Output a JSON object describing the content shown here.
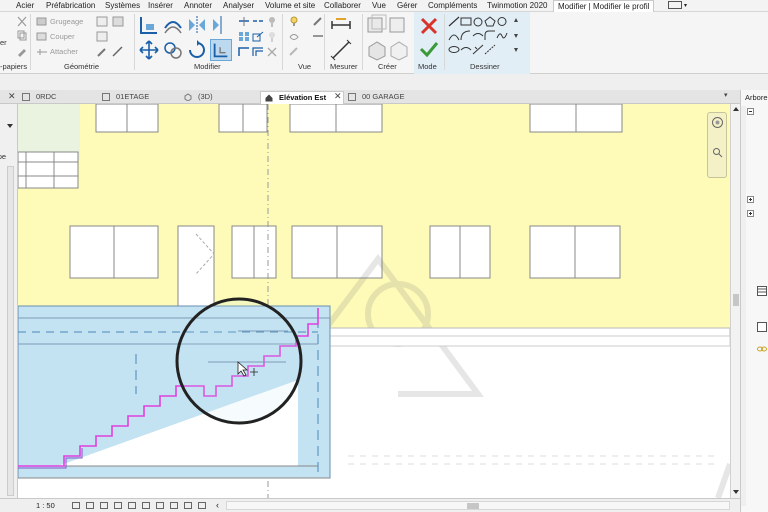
{
  "menu": {
    "items": [
      "Acier",
      "Préfabrication",
      "Systèmes",
      "Insérer",
      "Annoter",
      "Analyser",
      "Volume et site",
      "Collaborer",
      "Vue",
      "Gérer",
      "Compléments",
      "Twinmotion 2020"
    ],
    "active_tab": "Modifier | Modifier le profil"
  },
  "ribbon": {
    "clipboard_group": "-papiers",
    "clipboard_left_label": "er",
    "cmd_grugeage": "Grugeage",
    "cmd_couper": "Couper",
    "cmd_attacher": "Attacher",
    "panels": {
      "geometrie": "Géométrie",
      "modifier": "Modifier",
      "vue": "Vue",
      "mesurer": "Mesurer",
      "creer": "Créer",
      "mode": "Mode",
      "dessiner": "Dessiner"
    }
  },
  "tabs": [
    {
      "label": "0RDC",
      "active": false,
      "icon": "floorplan-icon"
    },
    {
      "label": "01ETAGE",
      "active": false,
      "icon": "floorplan-icon"
    },
    {
      "label": "(3D)",
      "active": false,
      "icon": "3d-view-icon"
    },
    {
      "label": "Elévation Est",
      "active": true,
      "icon": "home-icon"
    },
    {
      "label": "00 GARAGE",
      "active": false,
      "icon": "floorplan-icon"
    }
  ],
  "left_panel": {
    "label": "ype"
  },
  "browser": {
    "title": "Arbore"
  },
  "status": {
    "scale": "1 : 50"
  },
  "colors": {
    "facade": "#fefbb8",
    "blue_region": "#c3e2f2",
    "sketch_magenta": "#e040e0",
    "ribbon_mode_bg": "#e2eef6"
  }
}
